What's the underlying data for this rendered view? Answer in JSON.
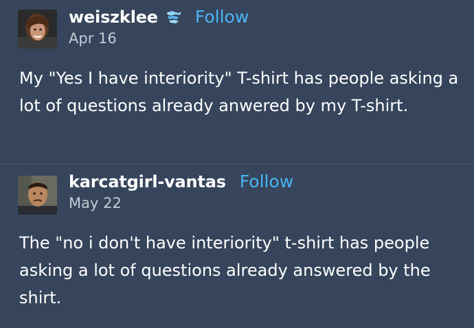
{
  "posts": [
    {
      "username": "weiszklee",
      "has_badge": true,
      "follow_label": "Follow",
      "date": "Apr 16",
      "text": "My \"Yes I have interiority\" T-shirt has people asking a lot of questions already anwered by my T-shirt."
    },
    {
      "username": "karcatgirl-vantas",
      "has_badge": false,
      "follow_label": "Follow",
      "date": "May 22",
      "text": "The \"no i don't have interiority\" t-shirt has people asking a lot of questions already answered by the shirt."
    }
  ],
  "colors": {
    "background": "#36455b",
    "follow": "#4bb4f5",
    "text": "#ffffff",
    "date": "#c5ccd6"
  }
}
